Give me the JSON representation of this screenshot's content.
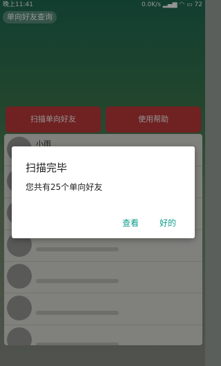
{
  "status_bar": {
    "time": "晚上11:41",
    "net": "0.0K/s",
    "battery": "72"
  },
  "app": {
    "title": "单向好友查询",
    "buttons": {
      "scan": "扫描单向好友",
      "help": "使用帮助"
    },
    "list": [
      {
        "name": "小雨"
      },
      {
        "name": ""
      },
      {
        "name": ""
      },
      {
        "name": ""
      },
      {
        "name": ""
      },
      {
        "name": ""
      },
      {
        "name": ""
      }
    ]
  },
  "dialog": {
    "title": "扫描完毕",
    "message": "您共有25个单向好友",
    "view": "查看",
    "ok": "好的"
  },
  "colors": {
    "accent": "#0f9d8a",
    "button_red": "#c23a3a"
  }
}
